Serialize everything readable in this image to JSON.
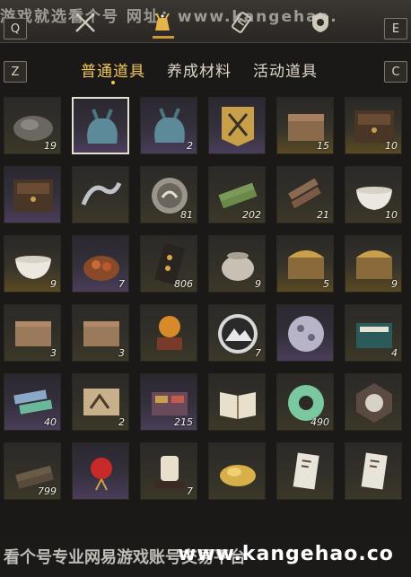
{
  "watermark": {
    "top": "游戏就选看个号 网址：www.kangehao.",
    "bottom_left": "看个号专业网易游戏账号交易平台",
    "bottom_url": "www.kangehao.co"
  },
  "keys": {
    "q": "Q",
    "e": "E",
    "z": "Z",
    "c": "C"
  },
  "top_icons": [
    "crossed-swords-icon",
    "pouch-icon",
    "scroll-icon",
    "shield-badge-icon"
  ],
  "tabs": [
    {
      "label": "普通道具",
      "active": true
    },
    {
      "label": "养成材料",
      "active": false
    },
    {
      "label": "活动道具",
      "active": false
    }
  ],
  "items": [
    {
      "icon": "ore-stone-icon",
      "qty": "19",
      "rarity": "normal"
    },
    {
      "icon": "cloth-bag-icon",
      "qty": "",
      "rarity": "purple",
      "selected": true
    },
    {
      "icon": "cloth-bag-icon",
      "qty": "2",
      "rarity": "purple"
    },
    {
      "icon": "sword-banner-icon",
      "qty": "",
      "rarity": "purple"
    },
    {
      "icon": "wooden-chest-icon",
      "qty": "15",
      "rarity": "gold"
    },
    {
      "icon": "cabinet-chest-icon",
      "qty": "10",
      "rarity": "gold"
    },
    {
      "icon": "cabinet-chest-icon",
      "qty": "",
      "rarity": "purple"
    },
    {
      "icon": "silver-dragon-icon",
      "qty": "",
      "rarity": "normal"
    },
    {
      "icon": "crane-medallion-icon",
      "qty": "81",
      "rarity": "normal"
    },
    {
      "icon": "bamboo-bundle-icon",
      "qty": "202",
      "rarity": "normal"
    },
    {
      "icon": "wood-logs-icon",
      "qty": "21",
      "rarity": "normal"
    },
    {
      "icon": "porcelain-bowl-icon",
      "qty": "10",
      "rarity": "normal"
    },
    {
      "icon": "porcelain-bowl-icon",
      "qty": "9",
      "rarity": "gold"
    },
    {
      "icon": "food-pot-icon",
      "qty": "7",
      "rarity": "purple"
    },
    {
      "icon": "flower-card-icon",
      "qty": "806",
      "rarity": "normal"
    },
    {
      "icon": "ceramic-jar-icon",
      "qty": "9",
      "rarity": "normal"
    },
    {
      "icon": "gold-chest-icon",
      "qty": "5",
      "rarity": "gold"
    },
    {
      "icon": "gold-chest-icon",
      "qty": "9",
      "rarity": "gold"
    },
    {
      "icon": "wood-crate-icon",
      "qty": "3",
      "rarity": "normal"
    },
    {
      "icon": "wood-crate-icon",
      "qty": "3",
      "rarity": "normal"
    },
    {
      "icon": "orb-pedestal-icon",
      "qty": "",
      "rarity": "normal"
    },
    {
      "icon": "mountain-token-icon",
      "qty": "7",
      "rarity": "normal"
    },
    {
      "icon": "spotted-ball-icon",
      "qty": "",
      "rarity": "purple"
    },
    {
      "icon": "gift-box-icon",
      "qty": "4",
      "rarity": "normal"
    },
    {
      "icon": "book-stack-icon",
      "qty": "40",
      "rarity": "purple"
    },
    {
      "icon": "painting-scroll-icon",
      "qty": "2",
      "rarity": "normal"
    },
    {
      "icon": "spice-box-icon",
      "qty": "215",
      "rarity": "purple"
    },
    {
      "icon": "open-book-icon",
      "qty": "",
      "rarity": "normal"
    },
    {
      "icon": "jade-ring-icon",
      "qty": "490",
      "rarity": "normal"
    },
    {
      "icon": "ornate-token-icon",
      "qty": "",
      "rarity": "normal"
    },
    {
      "icon": "log-pile-icon",
      "qty": "799",
      "rarity": "normal"
    },
    {
      "icon": "red-lantern-icon",
      "qty": "",
      "rarity": "purple"
    },
    {
      "icon": "jar-stand-icon",
      "qty": "7",
      "rarity": "normal"
    },
    {
      "icon": "gold-pile-icon",
      "qty": "",
      "rarity": "normal"
    },
    {
      "icon": "letter-card-icon",
      "qty": "",
      "rarity": "normal"
    },
    {
      "icon": "letter-card-icon",
      "qty": "",
      "rarity": "normal"
    }
  ],
  "colors": {
    "active_tab": "#f1c75f",
    "gold_glow": "#5a4a22",
    "purple_glow": "#4a3d5a"
  }
}
